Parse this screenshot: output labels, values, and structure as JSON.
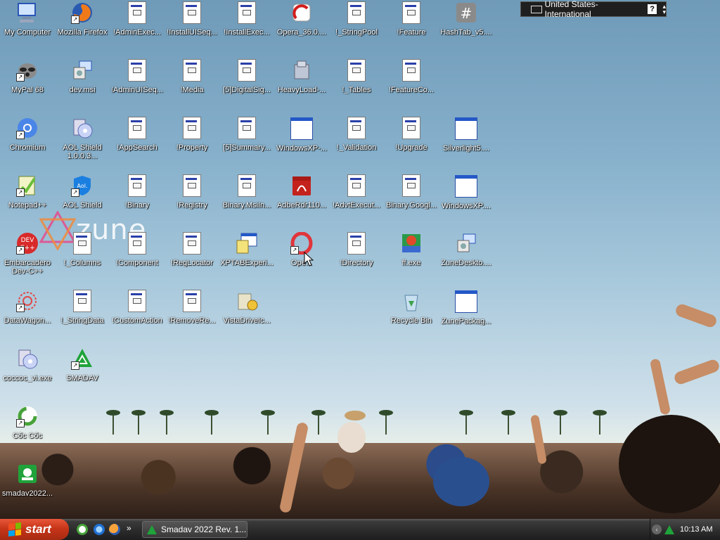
{
  "desktop": {
    "icons": [
      {
        "label": "My Computer"
      },
      {
        "label": "Mozilla Firefox"
      },
      {
        "label": "!AdminExec..."
      },
      {
        "label": "!InstallUISeq..."
      },
      {
        "label": "!InstallExec..."
      },
      {
        "label": "Opera_36.0...."
      },
      {
        "label": "!_StringPool"
      },
      {
        "label": "!Feature"
      },
      {
        "label": "HashTab_v5...."
      },
      {
        "label": "MyPal 68"
      },
      {
        "label": "dev.msi"
      },
      {
        "label": "!AdminUISeq..."
      },
      {
        "label": "!Media"
      },
      {
        "label": "[5]DigitalSig..."
      },
      {
        "label": "HeavyLoad-..."
      },
      {
        "label": "!_Tables"
      },
      {
        "label": "!FeatureCo..."
      },
      {
        "label": "Chromium"
      },
      {
        "label": "AOL Shield 1.0.0.3..."
      },
      {
        "label": "!AppSearch"
      },
      {
        "label": "!Property"
      },
      {
        "label": "[5]Summary..."
      },
      {
        "label": "WindowsXP-..."
      },
      {
        "label": "!_Validation"
      },
      {
        "label": "!Upgrade"
      },
      {
        "label": "Silverlight5...."
      },
      {
        "label": "Notepad++"
      },
      {
        "label": "AOL Shield"
      },
      {
        "label": "!Binary"
      },
      {
        "label": "!Registry"
      },
      {
        "label": "Binary.MsiIn..."
      },
      {
        "label": "AdbeRdr110..."
      },
      {
        "label": "!AdvtExecut..."
      },
      {
        "label": "Binary.Googl..."
      },
      {
        "label": "WindowsXP...."
      },
      {
        "label": "Embarcadero Dev-C++"
      },
      {
        "label": "!_Columns"
      },
      {
        "label": "!Component"
      },
      {
        "label": "!RegLocator"
      },
      {
        "label": "XPTABExperi..."
      },
      {
        "label": "Ope..."
      },
      {
        "label": "!Directory"
      },
      {
        "label": "ff.exe"
      },
      {
        "label": "ZuneDeskto...."
      },
      {
        "label": "DataWagon..."
      },
      {
        "label": "!_StringData"
      },
      {
        "label": "!CustomAction"
      },
      {
        "label": "!RemoveRe..."
      },
      {
        "label": "VistaDriveIc..."
      },
      {
        "label": "Recycle Bin"
      },
      {
        "label": "ZunePackag..."
      },
      {
        "label": "coccoc_vi.exe"
      },
      {
        "label": "SMADAV"
      },
      {
        "label": "Cốc Cốc"
      },
      {
        "label": "smadav2022..."
      }
    ],
    "wallpaper_logo": "zune"
  },
  "language_bar": {
    "language": "United States-International",
    "help_glyph": "?",
    "icon": "keyboard-icon"
  },
  "taskbar": {
    "start_label": "start",
    "quick_launch": [
      {
        "icon": "coccoc-icon"
      },
      {
        "icon": "internet-explorer-icon"
      },
      {
        "icon": "firefox-icon"
      }
    ],
    "overflow_glyph": "»",
    "tasks": [
      {
        "label": "Smadav 2022 Rev. 1...",
        "icon": "smadav-icon"
      }
    ],
    "tray": {
      "chevron_glyph": "‹",
      "clock": "10:13 AM"
    }
  },
  "colors": {
    "start_button": "#c73519",
    "taskbar": "#2b2b2b",
    "smadav_green": "#1fa33a",
    "icon_label_text": "#ffffff"
  }
}
